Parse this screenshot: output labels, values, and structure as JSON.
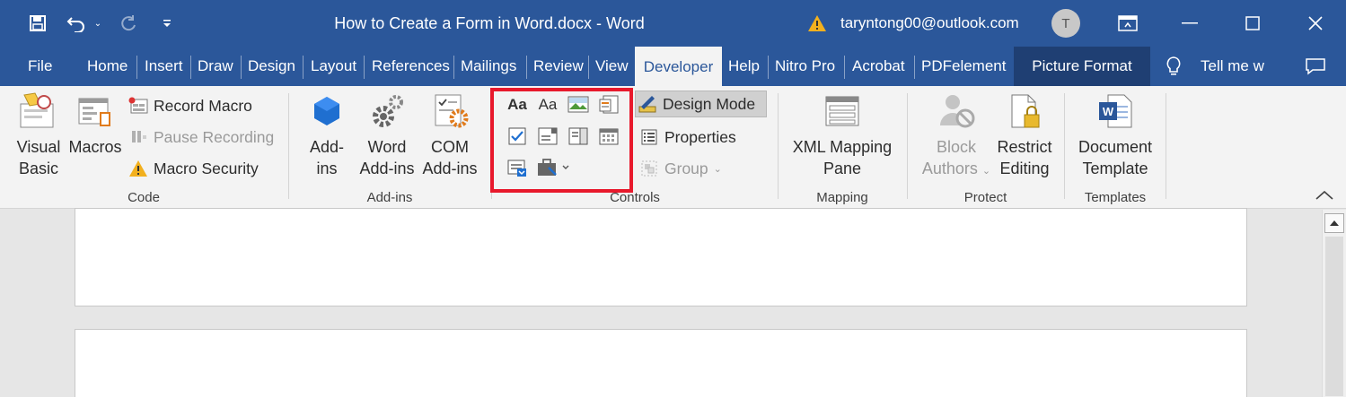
{
  "titlebar": {
    "title": "How to Create a Form in Word.docx  -  Word",
    "account_email": "taryntong00@outlook.com",
    "avatar_initial": "T"
  },
  "tabs": [
    "File",
    "Home",
    "Insert",
    "Draw",
    "Design",
    "Layout",
    "References",
    "Mailings",
    "Review",
    "View",
    "Developer",
    "Help",
    "Nitro Pro",
    "Acrobat",
    "PDFelement",
    "Picture Format"
  ],
  "tell_me": "Tell me w",
  "ribbon": {
    "code": {
      "label": "Code",
      "visual_basic": [
        "Visual",
        "Basic"
      ],
      "macros": "Macros",
      "record_macro": "Record Macro",
      "pause_recording": "Pause Recording",
      "macro_security": "Macro Security"
    },
    "addins": {
      "label": "Add-ins",
      "addins": [
        "Add-",
        "ins"
      ],
      "word_addins": [
        "Word",
        "Add-ins"
      ],
      "com_addins": [
        "COM",
        "Add-ins"
      ]
    },
    "controls": {
      "label": "Controls",
      "design_mode": "Design Mode",
      "properties": "Properties",
      "group": "Group"
    },
    "mapping": {
      "label": "Mapping",
      "xml_mapping_pane": [
        "XML Mapping",
        "Pane"
      ]
    },
    "protect": {
      "label": "Protect",
      "block_authors": [
        "Block",
        "Authors"
      ],
      "restrict_editing": [
        "Restrict",
        "Editing"
      ]
    },
    "templates": {
      "label": "Templates",
      "document_template": [
        "Document",
        "Template"
      ]
    }
  },
  "colors": {
    "title_bar": "#2b579a",
    "ribbon_bg": "#f3f3f3",
    "highlight": "#e8192c",
    "picture_format_tab": "#1f3f73"
  }
}
